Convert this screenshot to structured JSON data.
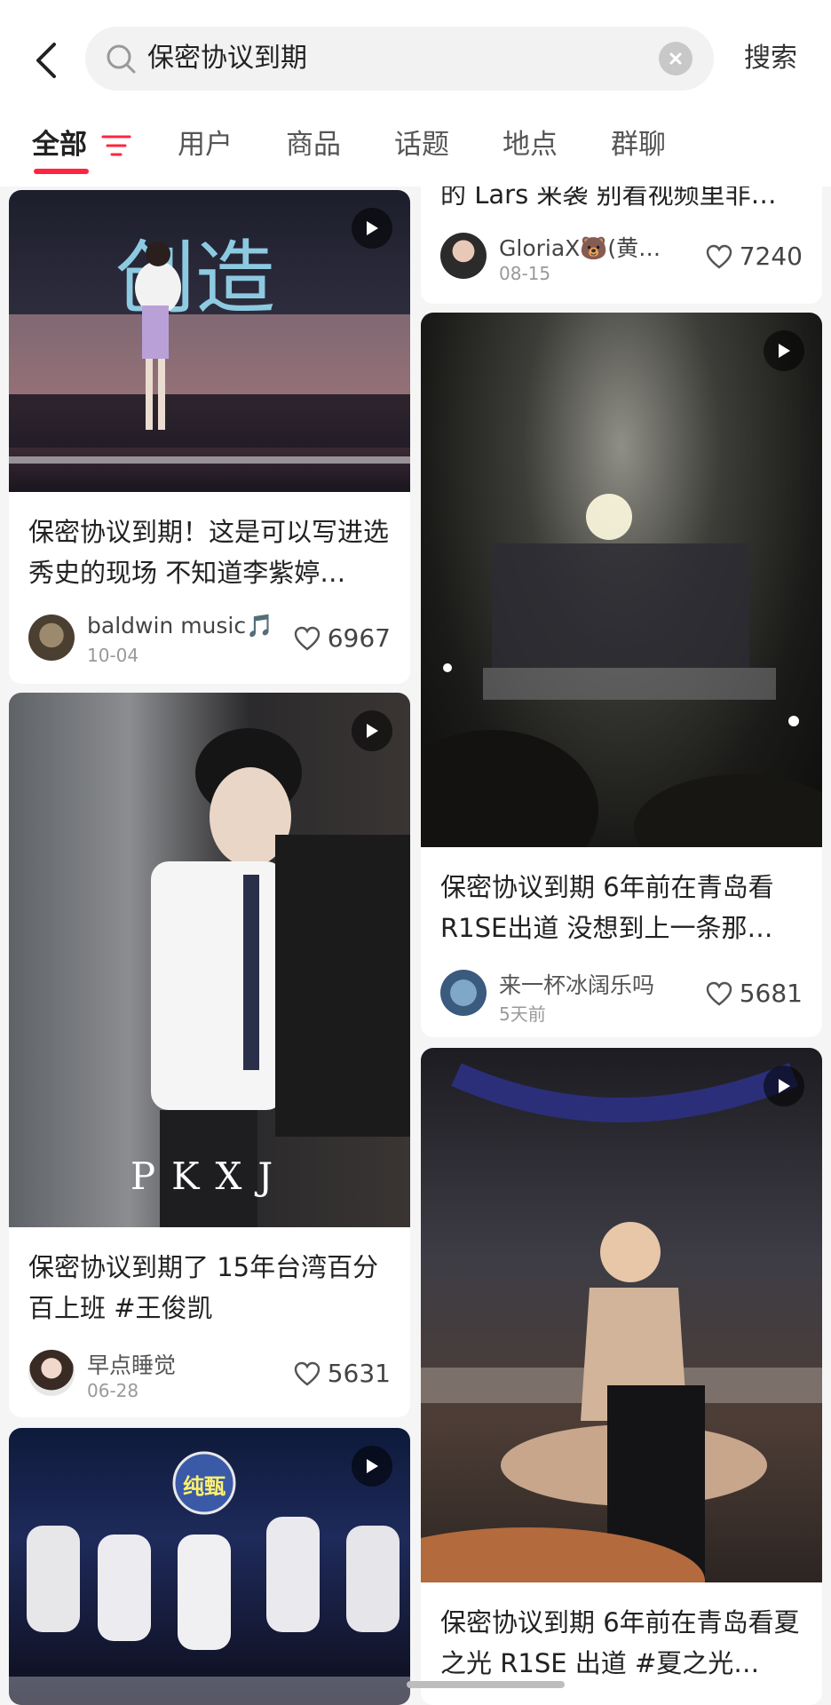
{
  "search": {
    "query": "保密协议到期",
    "submit_label": "搜索"
  },
  "tabs": [
    {
      "label": "全部"
    },
    {
      "label": "用户"
    },
    {
      "label": "商品"
    },
    {
      "label": "话题"
    },
    {
      "label": "地点"
    },
    {
      "label": "群聊"
    }
  ],
  "posts": {
    "p0": {
      "title": "的 Lars 来袭 别看视频里非…",
      "author": "GloriaX🐻(黄…",
      "date": "08-15",
      "likes": "7240"
    },
    "p1": {
      "title": "保密协议到期！这是可以写进选秀史的现场 不知道李紫婷…",
      "author": "baldwin music🎵",
      "date": "10-04",
      "likes": "6967"
    },
    "p2": {
      "title": "保密协议到期 6年前在青岛看R1SE出道 没想到上一条那…",
      "author": "来一杯冰阔乐吗",
      "date": "5天前",
      "likes": "5681"
    },
    "p3": {
      "title": "保密协议到期了 15年台湾百分百上班 #王俊凯",
      "author": "早点睡觉",
      "date": "06-28",
      "likes": "5631",
      "watermark": "PKXJ"
    },
    "p4": {
      "title": "保密协议到期 6年前在青岛看夏之光 R1SE 出道 #夏之光…"
    },
    "p5": {
      "overlay_text": "纯甄"
    }
  },
  "colors": {
    "accent": "#ff2442"
  }
}
